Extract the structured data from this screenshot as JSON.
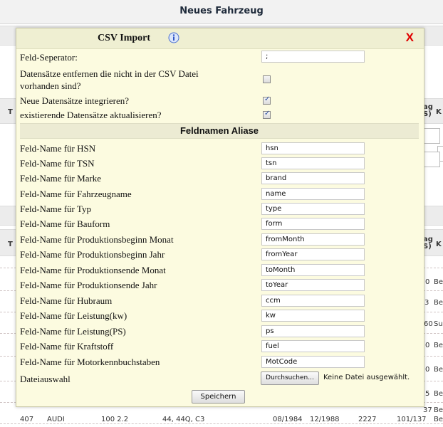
{
  "page": {
    "title": "Neues Fahrzeug",
    "edge_labels_top": [
      "T",
      "ag",
      "S)",
      "K"
    ],
    "edge_labels_mid": [
      "T",
      "ag",
      "S)",
      "K"
    ],
    "right_fragments": [
      "0",
      "Be",
      "3",
      "Be",
      "60",
      "Su",
      "0",
      "Be",
      "0",
      "Be",
      "5",
      "Be",
      "37",
      "Be"
    ],
    "bottom_row": [
      "407",
      "AUDI",
      "100 2.2",
      "44, 44Q, C3",
      "08/1984",
      "12/1988",
      "2227",
      "101/137",
      "Be"
    ]
  },
  "dialog": {
    "title": "CSV Import",
    "info_icon": "info-icon",
    "close_label": "X",
    "separator_label": "Feld-Seperator:",
    "separator_value": ";",
    "options": [
      {
        "label": "Datensätze entfernen die nicht in der CSV Datei vorhanden sind?",
        "checked": false
      },
      {
        "label": "Neue Datensätze integrieren?",
        "checked": true
      },
      {
        "label": "existierende Datensätze aktualisieren?",
        "checked": true
      }
    ],
    "section_title": "Feldnamen Aliase",
    "fields": [
      {
        "label": "Feld-Name für HSN",
        "value": "hsn"
      },
      {
        "label": "Feld-Name für TSN",
        "value": "tsn"
      },
      {
        "label": "Feld-Name für Marke",
        "value": "brand"
      },
      {
        "label": "Feld-Name für Fahrzeugname",
        "value": "name"
      },
      {
        "label": "Feld-Name für Typ",
        "value": "type"
      },
      {
        "label": "Feld-Name für Bauform",
        "value": "form"
      },
      {
        "label": "Feld-Name für Produktionsbeginn Monat",
        "value": "fromMonth"
      },
      {
        "label": "Feld-Name für Produktionsbeginn Jahr",
        "value": "fromYear"
      },
      {
        "label": "Feld-Name für Produktionsende Monat",
        "value": "toMonth"
      },
      {
        "label": "Feld-Name für Produktionsende Jahr",
        "value": "toYear"
      },
      {
        "label": "Feld-Name für Hubraum",
        "value": "ccm"
      },
      {
        "label": "Feld-Name für Leistung(kw)",
        "value": "kw"
      },
      {
        "label": "Feld-Name für Leistung(PS)",
        "value": "ps"
      },
      {
        "label": "Feld-Name für Kraftstoff",
        "value": "fuel"
      },
      {
        "label": "Feld-Name für Motorkennbuchstaben",
        "value": "MotCode"
      }
    ],
    "file_label": "Dateiauswahl",
    "file_button": "Durchsuchen...",
    "file_status": "Keine Datei ausgewählt.",
    "save_button": "Speichern",
    "colors": {
      "close": "#e00000",
      "background": "#fcfbe0",
      "header": "#efefd2",
      "check": "#2b4fa0"
    }
  }
}
